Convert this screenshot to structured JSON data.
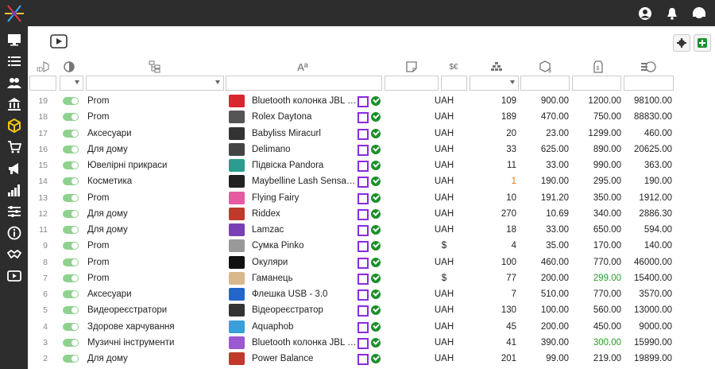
{
  "header": {
    "icons": [
      "user-circle-icon",
      "bell-icon",
      "support-headset-icon"
    ]
  },
  "sidebar": {
    "items": [
      "monitor-icon",
      "list-icon",
      "users-icon",
      "bank-icon",
      "box-icon",
      "cart-icon",
      "megaphone-icon",
      "bar-chart-icon",
      "sliders-icon",
      "info-icon",
      "handshake-icon",
      "video-icon"
    ],
    "active_index": 4
  },
  "toolbar": {
    "left_icon": "video-icon",
    "right_icons": [
      "gear-icon",
      "add-icon"
    ]
  },
  "columns": [
    {
      "key": "id",
      "icon": "cube-id-icon"
    },
    {
      "key": "active",
      "icon": "toggle-icon"
    },
    {
      "key": "category",
      "icon": "tree-icon"
    },
    {
      "key": "name",
      "icon": "text-icon",
      "label": "Aª"
    },
    {
      "key": "note",
      "icon": "note-icon"
    },
    {
      "key": "currency",
      "icon": "currency-icon",
      "label": "$€"
    },
    {
      "key": "quantity",
      "icon": "stack-icon"
    },
    {
      "key": "purchase_price",
      "icon": "box-dollar-icon"
    },
    {
      "key": "sale_price",
      "icon": "tag-dollar-icon"
    },
    {
      "key": "total",
      "icon": "coins-icon"
    }
  ],
  "rows": [
    {
      "id": "19",
      "category": "Prom",
      "name": "Bluetooth колонка JBL - ...",
      "currency": "UAH",
      "qty": "109",
      "p1": "900.00",
      "p2": "1200.00",
      "p3": "98100.00",
      "thumb": "#d8272f",
      "qty_color": "#222",
      "p2_color": "#222"
    },
    {
      "id": "18",
      "category": "Prom",
      "name": "Rolex Daytona",
      "currency": "UAH",
      "qty": "189",
      "p1": "470.00",
      "p2": "750.00",
      "p3": "88830.00",
      "thumb": "#555",
      "qty_color": "#222",
      "p2_color": "#222"
    },
    {
      "id": "17",
      "category": "Аксесуари",
      "name": "Babyliss Miracurl",
      "currency": "UAH",
      "qty": "20",
      "p1": "23.00",
      "p2": "1299.00",
      "p3": "460.00",
      "thumb": "#333",
      "qty_color": "#222",
      "p2_color": "#222"
    },
    {
      "id": "16",
      "category": "Для дому",
      "name": "Delimano",
      "currency": "UAH",
      "qty": "33",
      "p1": "625.00",
      "p2": "890.00",
      "p3": "20625.00",
      "thumb": "#444",
      "qty_color": "#222",
      "p2_color": "#222"
    },
    {
      "id": "15",
      "category": "Ювелірні прикраси",
      "name": "Підвіска Pandora",
      "currency": "UAH",
      "qty": "11",
      "p1": "33.00",
      "p2": "990.00",
      "p3": "363.00",
      "thumb": "#2a9d8f",
      "qty_color": "#222",
      "p2_color": "#222"
    },
    {
      "id": "14",
      "category": "Косметика",
      "name": "Maybelline Lash Sensati...",
      "currency": "UAH",
      "qty": "1",
      "p1": "190.00",
      "p2": "295.00",
      "p3": "190.00",
      "thumb": "#222",
      "qty_color": "#e07b00",
      "p2_color": "#222"
    },
    {
      "id": "13",
      "category": "Prom",
      "name": "Flying Fairy",
      "currency": "UAH",
      "qty": "10",
      "p1": "191.20",
      "p2": "350.00",
      "p3": "1912.00",
      "thumb": "#e85aa0",
      "qty_color": "#222",
      "p2_color": "#222"
    },
    {
      "id": "12",
      "category": "Для дому",
      "name": "Riddex",
      "currency": "UAH",
      "qty": "270",
      "p1": "10.69",
      "p2": "340.00",
      "p3": "2886.30",
      "thumb": "#c0392b",
      "qty_color": "#222",
      "p2_color": "#222"
    },
    {
      "id": "11",
      "category": "Для дому",
      "name": "Lamzac",
      "currency": "UAH",
      "qty": "18",
      "p1": "33.00",
      "p2": "650.00",
      "p3": "594.00",
      "thumb": "#7b3fb5",
      "qty_color": "#222",
      "p2_color": "#222"
    },
    {
      "id": "9",
      "category": "Prom",
      "name": "Сумка Pinko",
      "currency": "$",
      "qty": "4",
      "p1": "35.00",
      "p2": "170.00",
      "p3": "140.00",
      "thumb": "#999",
      "qty_color": "#222",
      "p2_color": "#222"
    },
    {
      "id": "8",
      "category": "Prom",
      "name": "Окуляри",
      "currency": "UAH",
      "qty": "100",
      "p1": "460.00",
      "p2": "770.00",
      "p3": "46000.00",
      "thumb": "#111",
      "qty_color": "#222",
      "p2_color": "#222"
    },
    {
      "id": "7",
      "category": "Prom",
      "name": "Гаманець",
      "currency": "$",
      "qty": "77",
      "p1": "200.00",
      "p2": "299.00",
      "p3": "15400.00",
      "thumb": "#d9b98b",
      "qty_color": "#222",
      "p2_color": "#2b9c2b"
    },
    {
      "id": "6",
      "category": "Аксесуари",
      "name": "Флешка USB - 3.0",
      "currency": "UAH",
      "qty": "7",
      "p1": "510.00",
      "p2": "770.00",
      "p3": "3570.00",
      "thumb": "#2266cc",
      "qty_color": "#222",
      "p2_color": "#222"
    },
    {
      "id": "5",
      "category": "Видеореєстратори",
      "name": "Відеореєстратор",
      "currency": "UAH",
      "qty": "130",
      "p1": "100.00",
      "p2": "560.00",
      "p3": "13000.00",
      "thumb": "#333",
      "qty_color": "#222",
      "p2_color": "#222"
    },
    {
      "id": "4",
      "category": "Здорове харчування",
      "name": "Aquaphob",
      "currency": "UAH",
      "qty": "45",
      "p1": "200.00",
      "p2": "450.00",
      "p3": "9000.00",
      "thumb": "#3aa0d8",
      "qty_color": "#222",
      "p2_color": "#222"
    },
    {
      "id": "3",
      "category": "Музичні інструменти",
      "name": "Bluetooth колонка JBL P...",
      "currency": "UAH",
      "qty": "41",
      "p1": "390.00",
      "p2": "300.00",
      "p3": "15990.00",
      "thumb": "#9b59d0",
      "qty_color": "#222",
      "p2_color": "#2b9c2b"
    },
    {
      "id": "2",
      "category": "Для дому",
      "name": "Power Balance",
      "currency": "UAH",
      "qty": "201",
      "p1": "99.00",
      "p2": "219.00",
      "p3": "19899.00",
      "thumb": "#c0392b",
      "qty_color": "#222",
      "p2_color": "#222"
    }
  ],
  "colors": {
    "topbar": "#2d2d2d",
    "toggle_on": "#8fd18f",
    "mark_purple": "#8a2be2",
    "ok_green": "#1b8f2d",
    "warn_orange": "#e07b00",
    "price_green": "#2b9c2b"
  }
}
